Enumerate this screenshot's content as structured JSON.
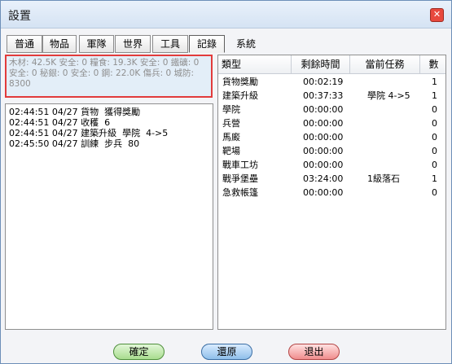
{
  "window": {
    "title": "設置",
    "close_icon": "close-icon"
  },
  "tabs": [
    {
      "label": "普通",
      "active": false
    },
    {
      "label": "物品",
      "active": false
    },
    {
      "label": "軍隊",
      "active": false
    },
    {
      "label": "世界",
      "active": false
    },
    {
      "label": "工具",
      "active": false
    },
    {
      "label": "記錄",
      "active": true
    },
    {
      "label": "系統",
      "active": false
    }
  ],
  "stats_text": "木材: 42.5K 安全: 0  糧食: 19.3K 安全: 0  鐵礦: 0 安全: 0  秘銀: 0 安全: 0  鋼: 22.0K  傷兵: 0  城防: 8300",
  "log_lines": [
    "02:44:51 04/27 貨物  獲得獎勵",
    "02:44:51 04/27 收穫  6",
    "02:44:51 04/27 建築升級  學院  4->5",
    "02:45:50 04/27 訓練  步兵  80"
  ],
  "table": {
    "headers": [
      "類型",
      "剩餘時間",
      "當前任務",
      "數"
    ],
    "rows": [
      [
        "貨物獎勵",
        "00:02:19",
        "",
        "1"
      ],
      [
        "建築升級",
        "00:37:33",
        "學院 4->5",
        "1"
      ],
      [
        "學院",
        "00:00:00",
        "",
        "0"
      ],
      [
        "兵營",
        "00:00:00",
        "",
        "0"
      ],
      [
        "馬廄",
        "00:00:00",
        "",
        "0"
      ],
      [
        "靶場",
        "00:00:00",
        "",
        "0"
      ],
      [
        "戰車工坊",
        "00:00:00",
        "",
        "0"
      ],
      [
        "戰爭堡壘",
        "03:24:00",
        "1級落石",
        "1"
      ],
      [
        "急救帳篷",
        "00:00:00",
        "",
        "0"
      ]
    ]
  },
  "buttons": {
    "ok": "確定",
    "restore": "還原",
    "exit": "退出"
  }
}
